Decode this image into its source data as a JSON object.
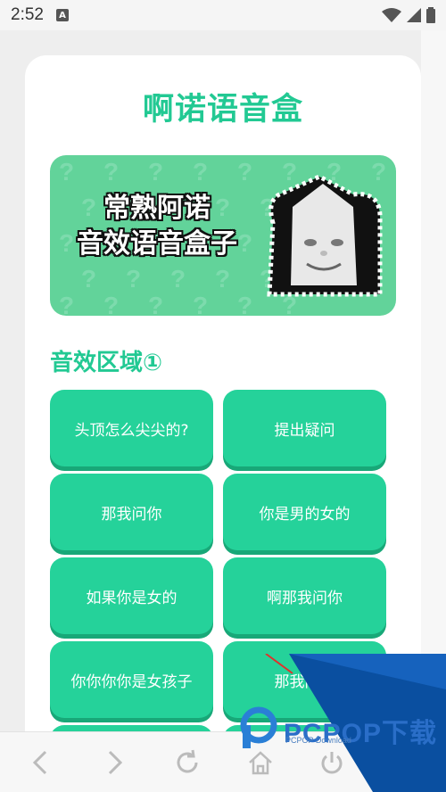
{
  "status_bar": {
    "time": "2:52",
    "app_icon_letter": "A"
  },
  "app": {
    "title": "啊诺语音盒"
  },
  "banner": {
    "line1": "常熟阿诺",
    "line2": "音效语音盒子"
  },
  "section": {
    "title": "音效区域①"
  },
  "sounds": [
    {
      "label": "头顶怎么尖尖的?"
    },
    {
      "label": "提出疑问"
    },
    {
      "label": "那我问你"
    },
    {
      "label": "你是男的女的"
    },
    {
      "label": "如果你是女的"
    },
    {
      "label": "啊那我问你"
    },
    {
      "label": "你你你你是女孩子"
    },
    {
      "label": "那我问你"
    }
  ],
  "watermark": {
    "brand": "PCPOP下载",
    "sub": "PCPOP Download"
  },
  "colors": {
    "accent": "#22c993",
    "button": "#25d29a",
    "banner": "#62d39a"
  },
  "nav": {
    "icons": [
      "back-icon",
      "forward-icon",
      "refresh-icon",
      "home-icon",
      "power-icon"
    ]
  }
}
